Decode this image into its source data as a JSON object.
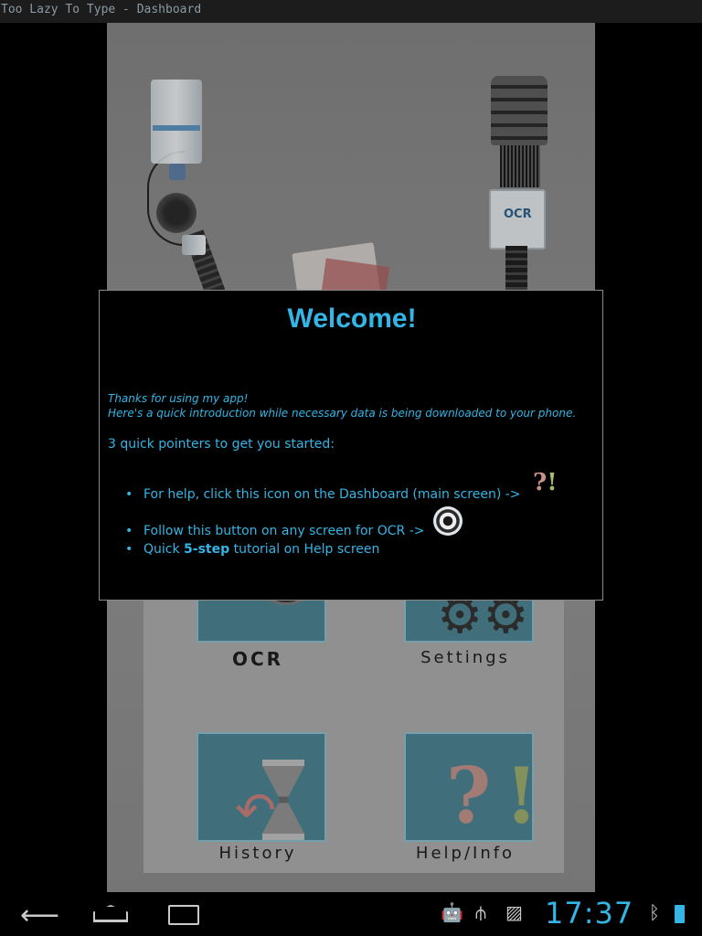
{
  "window": {
    "title": "Too Lazy To Type - Dashboard"
  },
  "header_art": {
    "ocr_badge": "OCR"
  },
  "dashboard": {
    "tiles": [
      {
        "label": "OCR",
        "icon": "camera-lens-icon"
      },
      {
        "label": "Settings",
        "icon": "gears-icon"
      },
      {
        "label": "History",
        "icon": "hourglass-icon"
      },
      {
        "label": "Help/Info",
        "icon": "question-exclamation-icon"
      }
    ]
  },
  "dialog": {
    "title": "Welcome!",
    "intro_line1": "Thanks for using my app!",
    "intro_line2": "Here's a quick introduction while necessary data is being downloaded to your phone.",
    "pointers_heading": "3 quick pointers to get you started:",
    "bullets": {
      "help": "For help, click this icon on the Dashboard (main screen) ->",
      "ocr": "Follow this button on any screen for OCR ->",
      "tutorial_prefix": "Quick ",
      "tutorial_bold": "5-step",
      "tutorial_suffix": " tutorial on Help screen"
    },
    "inline_help_q": "?",
    "inline_help_e": "!"
  },
  "navbar": {
    "back_icon": "back-icon",
    "home_icon": "home-icon",
    "recent_icon": "recent-apps-icon",
    "time": "17:37"
  },
  "colors": {
    "accent": "#33b5e5",
    "dialog_bg": "#000000"
  }
}
